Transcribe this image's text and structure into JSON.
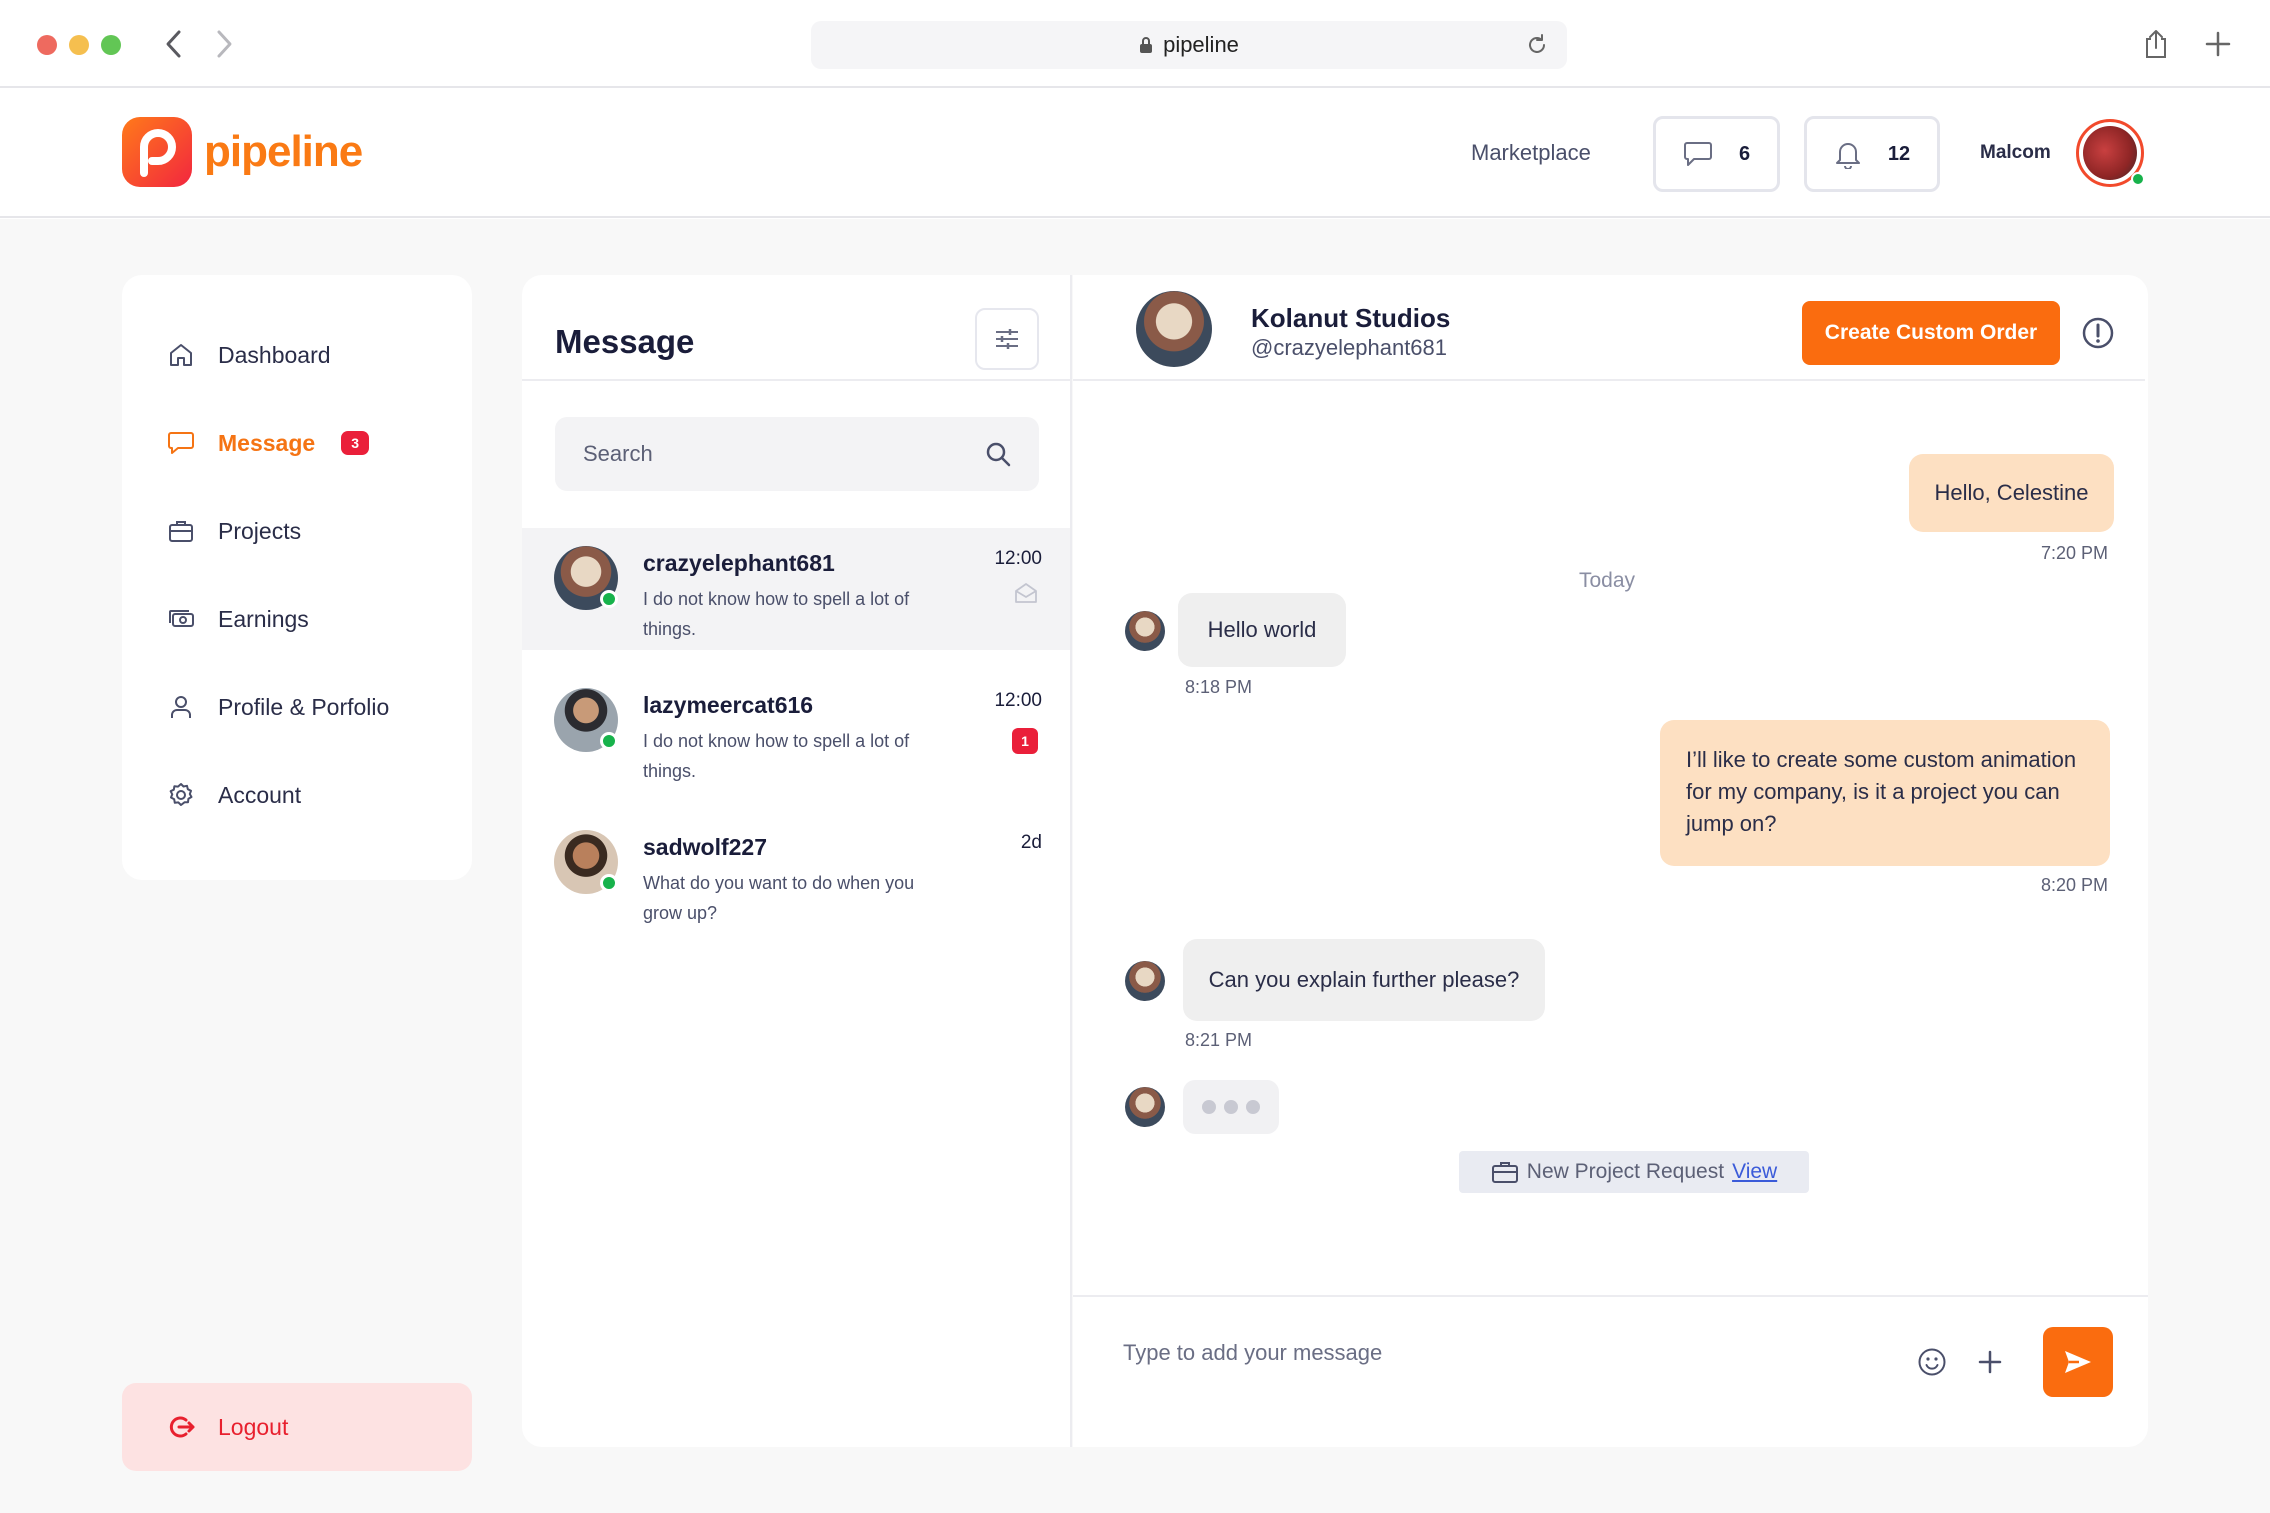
{
  "browser": {
    "url": "pipeline"
  },
  "header": {
    "logo_text": "pipeline",
    "marketplace_label": "Marketplace",
    "messages_count": "6",
    "notifications_count": "12",
    "username": "Malcom"
  },
  "sidebar": {
    "items": [
      {
        "label": "Dashboard",
        "icon": "home-icon"
      },
      {
        "label": "Message",
        "icon": "chat-icon",
        "badge": "3"
      },
      {
        "label": "Projects",
        "icon": "briefcase-icon"
      },
      {
        "label": "Earnings",
        "icon": "money-icon"
      },
      {
        "label": "Profile & Porfolio",
        "icon": "user-icon"
      },
      {
        "label": "Account",
        "icon": "gear-icon"
      }
    ],
    "logout_label": "Logout"
  },
  "messages": {
    "title": "Message",
    "search_placeholder": "Search",
    "conversations": [
      {
        "name": "crazyelephant681",
        "preview": "I do not know how to spell a lot of things.",
        "time": "12:00",
        "status": "read"
      },
      {
        "name": "lazymeercat616",
        "preview": "I do not know how to spell a lot of things.",
        "time": "12:00",
        "unread": "1"
      },
      {
        "name": "sadwolf227",
        "preview": "What do you want to do when you grow up?",
        "time": "2d"
      }
    ]
  },
  "chat": {
    "contact_name": "Kolanut Studios",
    "contact_handle": "@crazyelephant681",
    "create_order_label": "Create Custom Order",
    "day_separator": "Today",
    "messages": [
      {
        "direction": "out",
        "text": "Hello, Celestine",
        "time": "7:20 PM"
      },
      {
        "direction": "in",
        "text": "Hello world",
        "time": "8:18 PM"
      },
      {
        "direction": "out",
        "text": "I’ll like to create some custom animation for my company, is it a project you can jump on?",
        "time": "8:20 PM"
      },
      {
        "direction": "in",
        "text": "Can you explain further please?",
        "time": "8:21 PM"
      }
    ],
    "project_request_text": "New Project Request",
    "project_request_link": "View",
    "composer_placeholder": "Type to add your message"
  },
  "colors": {
    "accent": "#fa6c0f",
    "danger": "#ea1f3a",
    "online": "#17b24b",
    "outgoing_bubble": "#fde0c2"
  }
}
